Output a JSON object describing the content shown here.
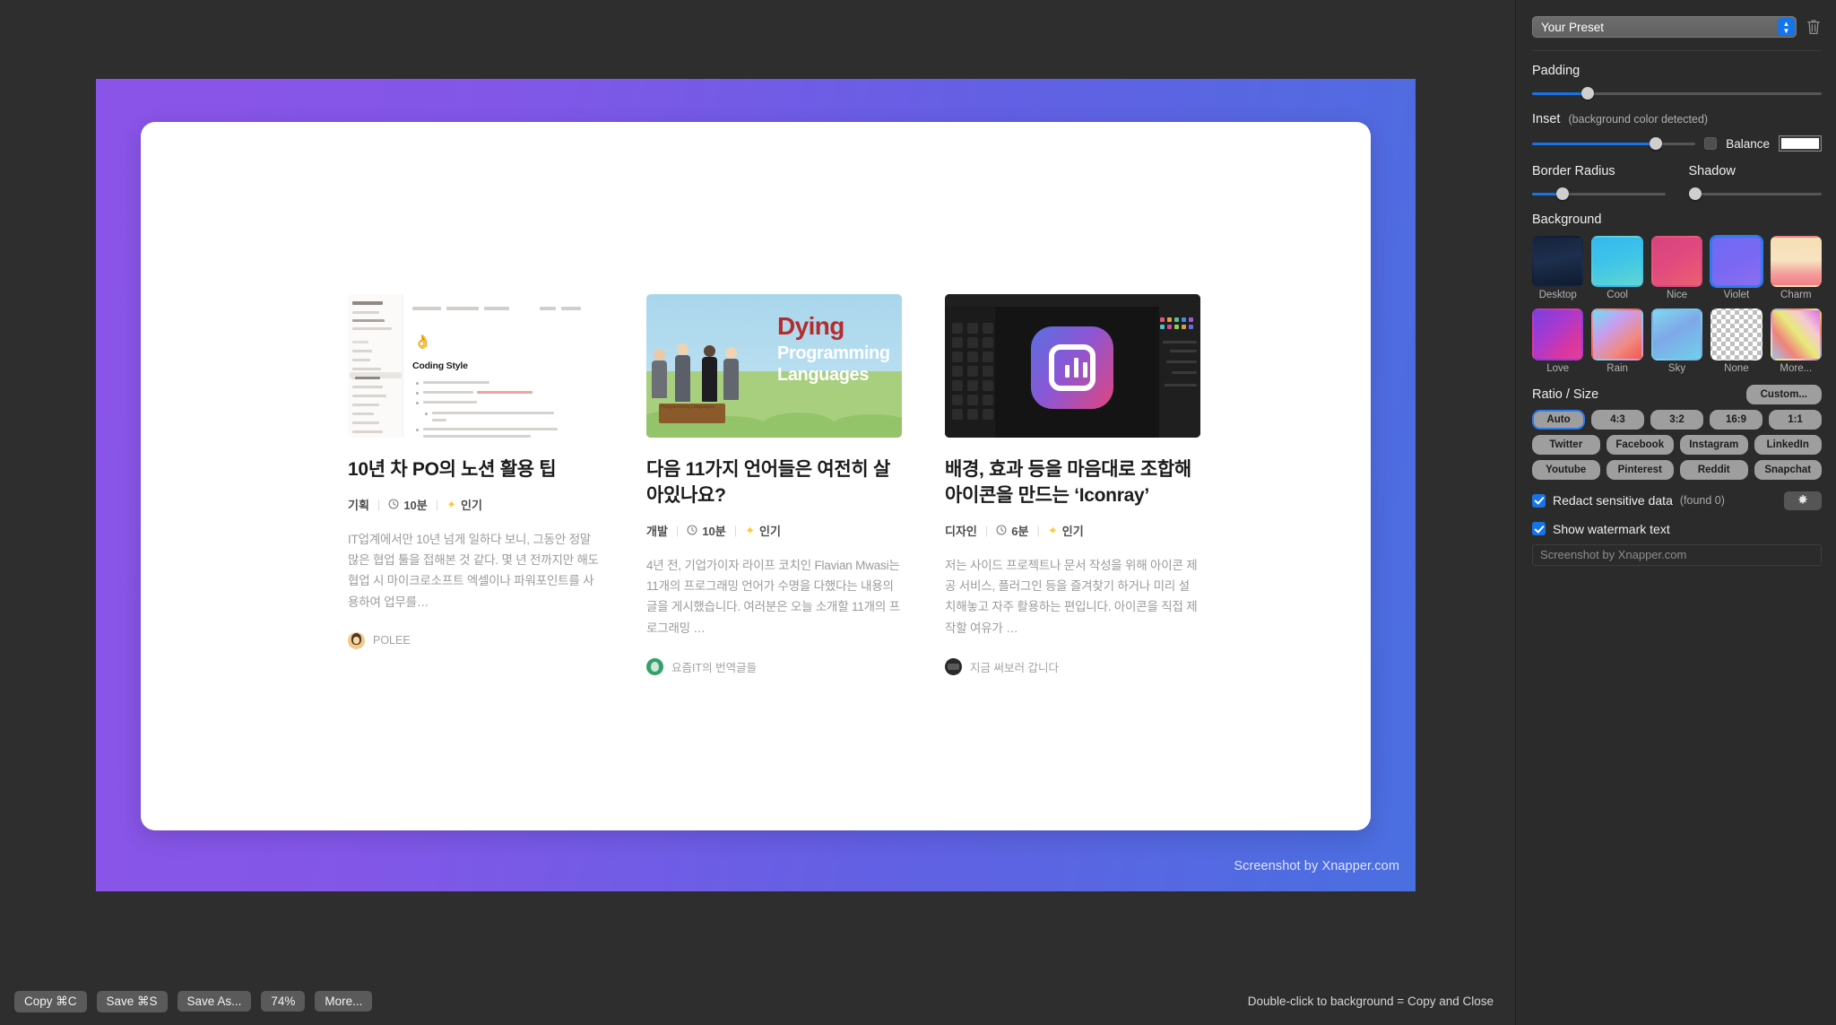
{
  "app": {
    "bottom_bar": {
      "buttons": [
        {
          "name": "copy-button",
          "label": "Copy ⌘C"
        },
        {
          "name": "save-button",
          "label": "Save ⌘S"
        },
        {
          "name": "save-as-button",
          "label": "Save As..."
        },
        {
          "name": "zoom-button",
          "label": "74%"
        },
        {
          "name": "more-button",
          "label": "More..."
        }
      ],
      "hint": "Double-click to background = Copy and Close"
    }
  },
  "panel": {
    "preset": {
      "value": "Your Preset",
      "delete_icon": "trash-icon",
      "stepper_icon": "stepper-up-down-icon"
    },
    "padding": {
      "label": "Padding",
      "fill_percent": 23
    },
    "inset": {
      "label": "Inset",
      "note": "(background color detected)",
      "fill_percent": 76,
      "balance_label": "Balance",
      "balance_checked": false,
      "color": "#ffffff"
    },
    "border_radius": {
      "label": "Border Radius",
      "fill_percent": 22
    },
    "shadow": {
      "label": "Shadow",
      "fill_percent": 2
    },
    "background": {
      "label": "Background",
      "selected": "Violet",
      "items": [
        {
          "name": "Desktop",
          "css": "linear-gradient(170deg,#16233c 0%,#1d2f4e 45%,#0f1a2e 100%)"
        },
        {
          "name": "Cool",
          "css": "linear-gradient(165deg,#35b7ef 0%,#3fc5e8 50%,#5fd6d2 100%)"
        },
        {
          "name": "Nice",
          "css": "linear-gradient(150deg,#d6447e 0%,#e0497f 45%,#ec5f72 100%)"
        },
        {
          "name": "Violet",
          "css": "linear-gradient(155deg,#6f6bf4 0%,#7a68f2 50%,#8a6ef0 100%)"
        },
        {
          "name": "Charm",
          "css": "linear-gradient(180deg,#f6dfb4 0%,#f7e3c0 48%,#f39a9a 78%,#f07f86 100%)"
        },
        {
          "name": "Love",
          "css": "linear-gradient(135deg,#7b3fe0 0%,#a63ad0 40%,#d9369f 75%,#e0409b 100%)"
        },
        {
          "name": "Rain",
          "css": "linear-gradient(140deg,#6fe0f0 0%,#c79ef0 35%,#f08a80 70%,#f0584e 100%)"
        },
        {
          "name": "Sky",
          "css": "linear-gradient(150deg,#7fd8f0 0%,#7fa8e8 45%,#6fd0ea 100%)"
        },
        {
          "name": "None",
          "css": "transparent"
        },
        {
          "name": "More...",
          "css": "linear-gradient(50deg,#9fc0ef 0%,#f0837a 28%,#e8ea7a 52%,#f5c9d4 74%,#d96fe8 100%)"
        }
      ]
    },
    "ratio": {
      "label": "Ratio / Size",
      "custom_label": "Custom...",
      "selected": "Auto",
      "row1": [
        "Auto",
        "4:3",
        "3:2",
        "16:9",
        "1:1"
      ],
      "row2": [
        "Twitter",
        "Facebook",
        "Instagram",
        "LinkedIn"
      ],
      "row3": [
        "Youtube",
        "Pinterest",
        "Reddit",
        "Snapchat"
      ]
    },
    "redact": {
      "label": "Redact sensitive data",
      "found": "(found 0)",
      "checked": true,
      "gear_icon": "gear-icon"
    },
    "watermark": {
      "label": "Show watermark text",
      "checked": true,
      "input_placeholder": "Screenshot by Xnapper.com",
      "input_value": ""
    }
  },
  "canvas": {
    "watermark_text": "Screenshot by Xnapper.com",
    "background_gradient": {
      "from": "#8b54e8",
      "to": "#4a6fe0"
    },
    "articles": [
      {
        "thumb_kind": "notion",
        "thumb_alt": "Notion app screenshot of a Coding Style page",
        "thumb_heading": "Coding Style",
        "thumb_emoji": "👌",
        "title": "10년 차 PO의 노션 활용 팁",
        "category": "기획",
        "read_time": "10분",
        "badge": "인기",
        "excerpt": "IT업계에서만 10년 넘게 일하다 보니, 그동안 정말 많은 협업 툴을 접해본 것 같다. 몇 년 전까지만 해도 협업 시 마이크로소프트 엑셀이나 파워포인트를 사용하여 업무를…",
        "author": "POLEE",
        "avatar_kind": "polee"
      },
      {
        "thumb_kind": "dying",
        "thumb_alt": "Illustration of a funeral for programming languages",
        "thumb_title": "Dying",
        "thumb_sub1": "Programming",
        "thumb_sub2": "Languages",
        "thumb_coffin_label": "Programming Languages",
        "title": "다음 11가지 언어들은 여전히 살아있나요?",
        "category": "개발",
        "read_time": "10분",
        "badge": "인기",
        "excerpt": "4년 전, 기업가이자 라이프 코치인 Flavian Mwasi는 11개의 프로그래밍 언어가 수명을 다했다는 내용의 글을 게시했습니다. 여러분은 오늘 소개할 11개의 프로그래밍 …",
        "author": "요즘IT의 번역글들",
        "avatar_kind": "green"
      },
      {
        "thumb_kind": "darktool",
        "thumb_alt": "Dark design tool showing a gradient app icon with bar chart glyph",
        "title": "배경, 효과 등을 마음대로 조합해 아이콘을 만드는 ‘Iconray’",
        "category": "디자인",
        "read_time": "6분",
        "badge": "인기",
        "excerpt": "저는 사이드 프로젝트나 문서 작성을 위해 아이콘 제공 서비스, 플러그인 등을 즐겨찾기 하거나 미리 설치해놓고 자주 활용하는 편입니다. 아이콘을 직접 제작할 여유가 …",
        "author": "지금 써보러 갑니다",
        "avatar_kind": "dark"
      }
    ]
  }
}
